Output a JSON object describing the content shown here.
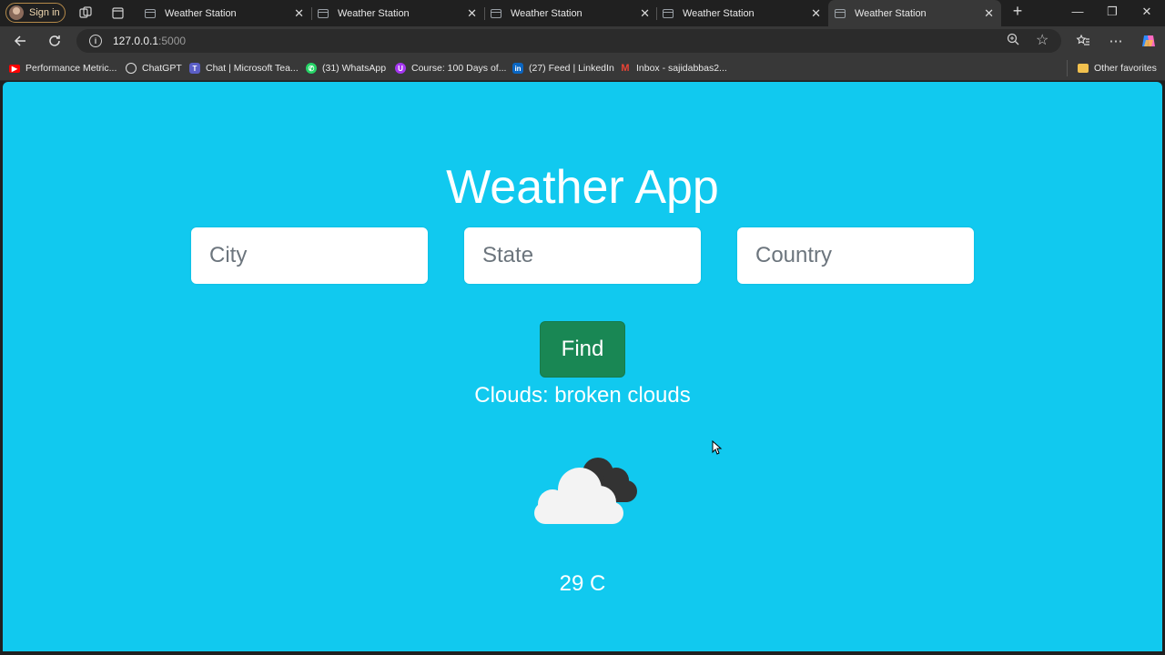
{
  "browser": {
    "signin_label": "Sign in",
    "tabs": [
      {
        "title": "Weather Station",
        "active": false
      },
      {
        "title": "Weather Station",
        "active": false
      },
      {
        "title": "Weather Station",
        "active": false
      },
      {
        "title": "Weather Station",
        "active": false
      },
      {
        "title": "Weather Station",
        "active": true
      }
    ],
    "url_host": "127.0.0.1",
    "url_port": ":5000",
    "bookmarks": [
      {
        "label": "Performance Metric...",
        "icon": "youtube-icon",
        "color": "#ff0000"
      },
      {
        "label": "ChatGPT",
        "icon": "chatgpt-icon",
        "color": "#202020"
      },
      {
        "label": "Chat | Microsoft Tea...",
        "icon": "teams-icon",
        "color": "#5b5fc7"
      },
      {
        "label": "(31) WhatsApp",
        "icon": "whatsapp-icon",
        "color": "#25d366"
      },
      {
        "label": "Course: 100 Days of...",
        "icon": "course-icon",
        "color": "#a435f0"
      },
      {
        "label": "(27) Feed | LinkedIn",
        "icon": "linkedin-icon",
        "color": "#0a66c2"
      },
      {
        "label": "Inbox - sajidabbas2...",
        "icon": "gmail-icon",
        "color": "#ea4335"
      }
    ],
    "other_favorites": "Other favorites"
  },
  "app": {
    "title": "Weather App",
    "inputs": {
      "city_placeholder": "City",
      "state_placeholder": "State",
      "country_placeholder": "Country"
    },
    "find_label": "Find",
    "description": "Clouds: broken clouds",
    "weather_icon": "broken-clouds-icon",
    "temperature": "29 C",
    "background_color": "#11c9ef",
    "button_color": "#198754"
  }
}
